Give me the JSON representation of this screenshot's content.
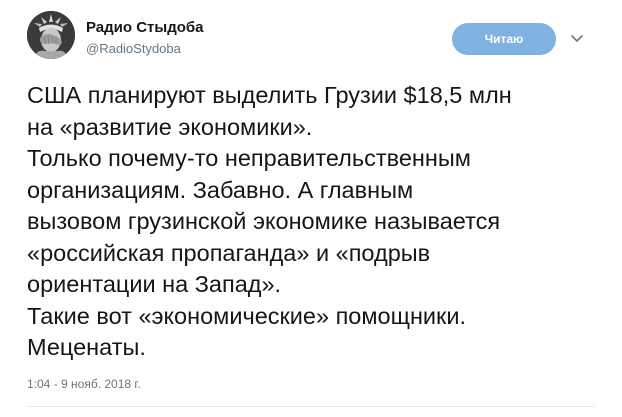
{
  "author": {
    "display_name": "Радио Стыдоба",
    "handle": "@RadioStydoba",
    "avatar_icon": "statue-of-liberty-facepalm-avatar"
  },
  "follow_button": {
    "label": "Читаю",
    "color": "#7fb2e0"
  },
  "menu": {
    "icon": "chevron-down-icon"
  },
  "tweet": {
    "lines": [
      "США планируют выделить Грузии $18,5 млн",
      "на «развитие экономики».",
      "Только почему-то неправительственным",
      "организациям. Забавно. А главным",
      "вызовом грузинской экономике называется",
      "«российская пропаганда» и «подрыв",
      "ориентации на Запад».",
      "Такие вот «экономические» помощники.",
      "Меценаты."
    ],
    "timestamp": "1:04 - 9 нояб. 2018 г."
  }
}
